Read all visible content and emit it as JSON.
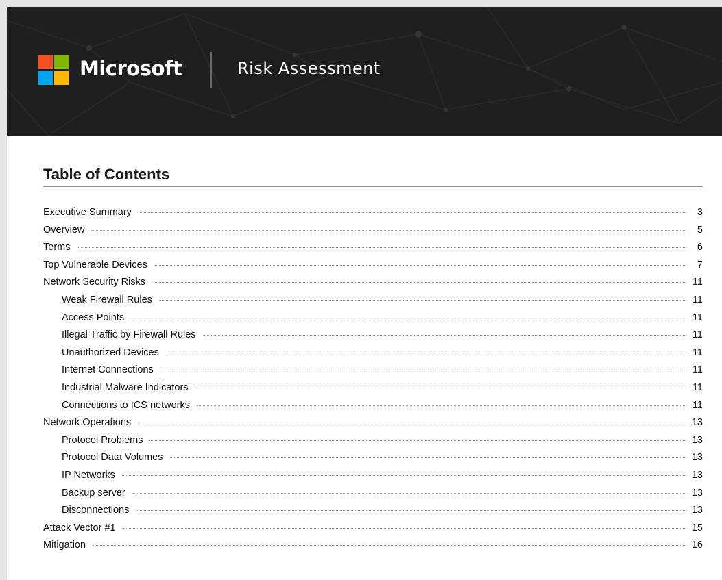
{
  "header": {
    "brand": "Microsoft",
    "title": "Risk Assessment",
    "background_color": "#1f1f1f",
    "logo_colors": [
      "#f25022",
      "#7fba00",
      "#00a4ef",
      "#ffb900"
    ]
  },
  "toc": {
    "heading": "Table of Contents",
    "entries": [
      {
        "title": "Executive Summary",
        "page": "3",
        "level": 1
      },
      {
        "title": "Overview",
        "page": "5",
        "level": 1
      },
      {
        "title": "Terms",
        "page": "6",
        "level": 1
      },
      {
        "title": "Top Vulnerable Devices",
        "page": "7",
        "level": 1
      },
      {
        "title": "Network Security Risks",
        "page": "11",
        "level": 1
      },
      {
        "title": "Weak Firewall Rules",
        "page": "11",
        "level": 2
      },
      {
        "title": "Access Points",
        "page": "11",
        "level": 2
      },
      {
        "title": "Illegal Traffic by Firewall Rules",
        "page": "11",
        "level": 2
      },
      {
        "title": "Unauthorized Devices",
        "page": "11",
        "level": 2
      },
      {
        "title": "Internet Connections",
        "page": "11",
        "level": 2
      },
      {
        "title": "Industrial Malware Indicators",
        "page": "11",
        "level": 2
      },
      {
        "title": "Connections to ICS networks",
        "page": "11",
        "level": 2
      },
      {
        "title": "Network Operations",
        "page": "13",
        "level": 1
      },
      {
        "title": "Protocol Problems",
        "page": "13",
        "level": 2
      },
      {
        "title": "Protocol Data Volumes",
        "page": "13",
        "level": 2
      },
      {
        "title": "IP Networks",
        "page": "13",
        "level": 2
      },
      {
        "title": "Backup server",
        "page": "13",
        "level": 2
      },
      {
        "title": "Disconnections",
        "page": "13",
        "level": 2
      },
      {
        "title": "Attack Vector #1",
        "page": "15",
        "level": 1
      },
      {
        "title": "Mitigation",
        "page": "16",
        "level": 1
      }
    ]
  }
}
